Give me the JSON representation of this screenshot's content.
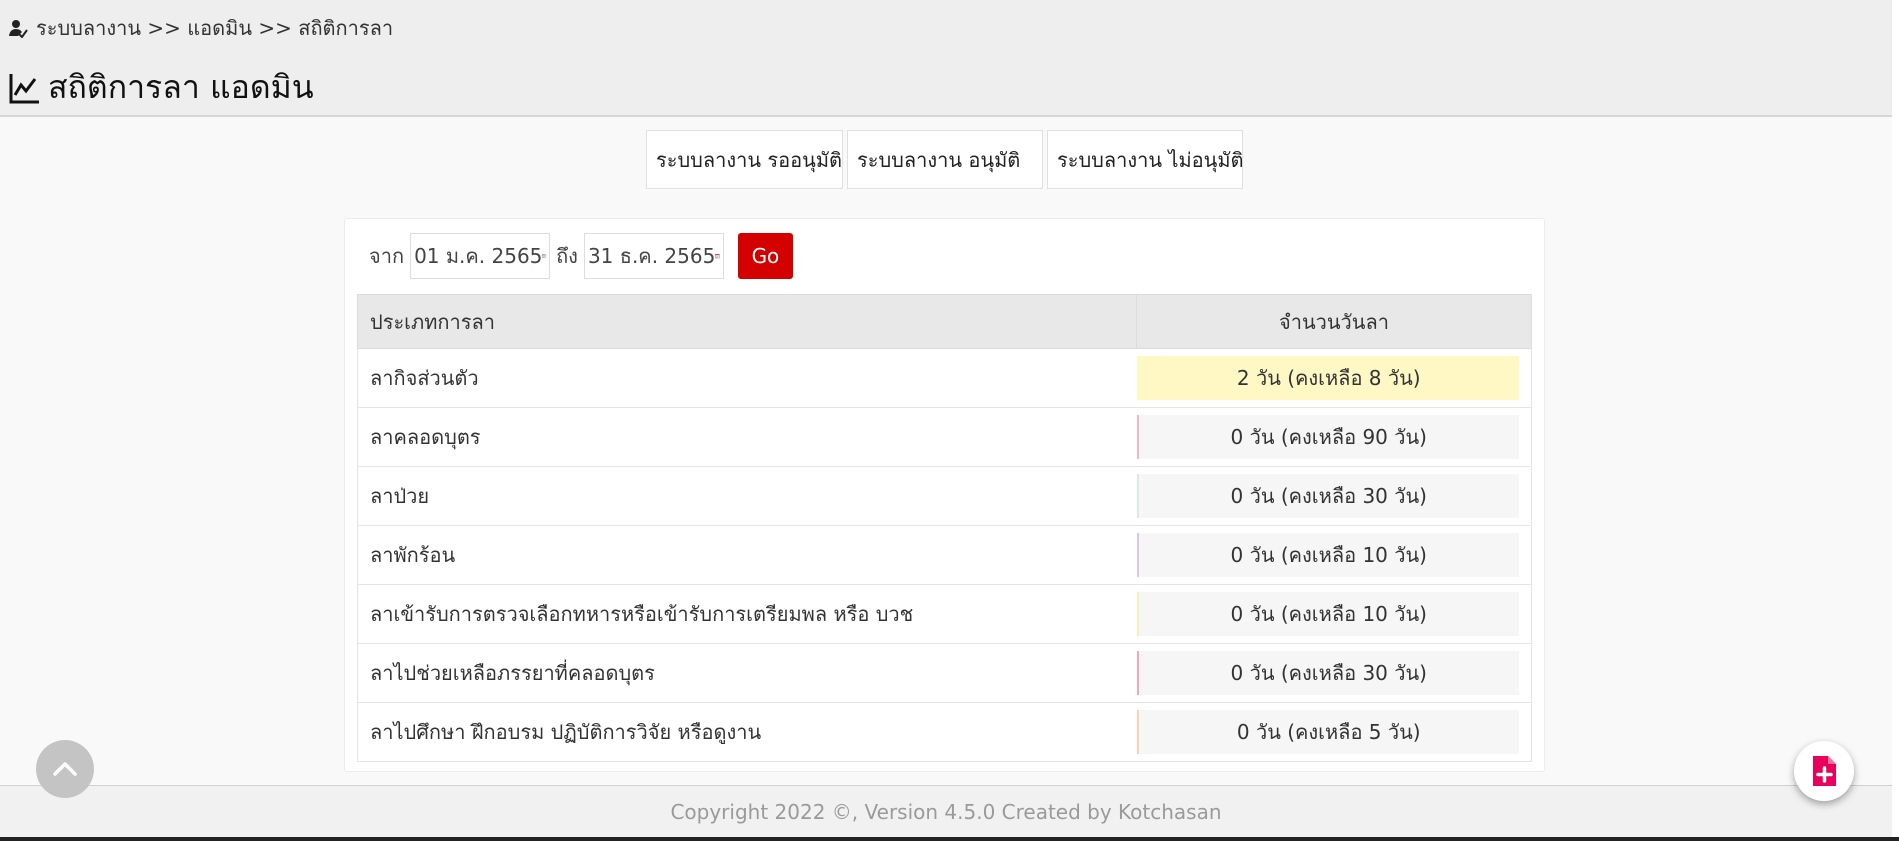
{
  "breadcrumb": {
    "text": "ระบบลางาน >> แอดมิน >> สถิติการลา"
  },
  "page": {
    "title": "สถิติการลา แอดมิน"
  },
  "tabs": [
    {
      "label": "ระบบลางาน รออนุมัติ"
    },
    {
      "label": "ระบบลางาน อนุมัติ"
    },
    {
      "label": "ระบบลางาน ไม่อนุมัติ"
    }
  ],
  "filter": {
    "from_label": "จาก",
    "from_value": "01 ม.ค. 2565",
    "to_label": "ถึง",
    "to_value": "31 ธ.ค. 2565",
    "go_label": "Go"
  },
  "table": {
    "headers": {
      "type": "ประเภทการลา",
      "days": "จำนวนวันลา"
    },
    "rows": [
      {
        "type": "ลากิจส่วนตัว",
        "days": "2 วัน (คงเหลือ 8 วัน)",
        "color": "#fff8c5",
        "accent": "#fff8c5"
      },
      {
        "type": "ลาคลอดบุตร",
        "days": "0 วัน (คงเหลือ 90 วัน)",
        "color": "#f6f6f6",
        "accent": "#f4b6c2"
      },
      {
        "type": "ลาป่วย",
        "days": "0 วัน (คงเหลือ 30 วัน)",
        "color": "#f6f6f6",
        "accent": "#cfeee5"
      },
      {
        "type": "ลาพักร้อน",
        "days": "0 วัน (คงเหลือ 10 วัน)",
        "color": "#f6f6f6",
        "accent": "#d8c8f0"
      },
      {
        "type": "ลาเข้ารับการตรวจเลือกทหารหรือเข้ารับการเตรียมพล หรือ บวช",
        "days": "0 วัน (คงเหลือ 10 วัน)",
        "color": "#f6f6f6",
        "accent": "#f6f0b8"
      },
      {
        "type": "ลาไปช่วยเหลือภรรยาที่คลอดบุตร",
        "days": "0 วัน (คงเหลือ 30 วัน)",
        "color": "#f6f6f6",
        "accent": "#f0a8b4"
      },
      {
        "type": "ลาไปศึกษา ฝึกอบรม ปฏิบัติการวิจัย หรือดูงาน",
        "days": "0 วัน (คงเหลือ 5 วัน)",
        "color": "#f6f6f6",
        "accent": "#f6d2b0"
      }
    ]
  },
  "footer": {
    "text": "Copyright 2022 ©, Version 4.5.0 Created by Kotchasan"
  },
  "colors": {
    "go_button": "#d40000",
    "new_doc_icon": "#e8005a",
    "scroll_top_bg": "#c4c4c4"
  },
  "icons": {
    "breadcrumb": "user-icon",
    "title": "line-chart-icon",
    "date": "calendar-icon",
    "scroll_top": "chevron-up-icon",
    "fab": "file-plus-icon"
  }
}
